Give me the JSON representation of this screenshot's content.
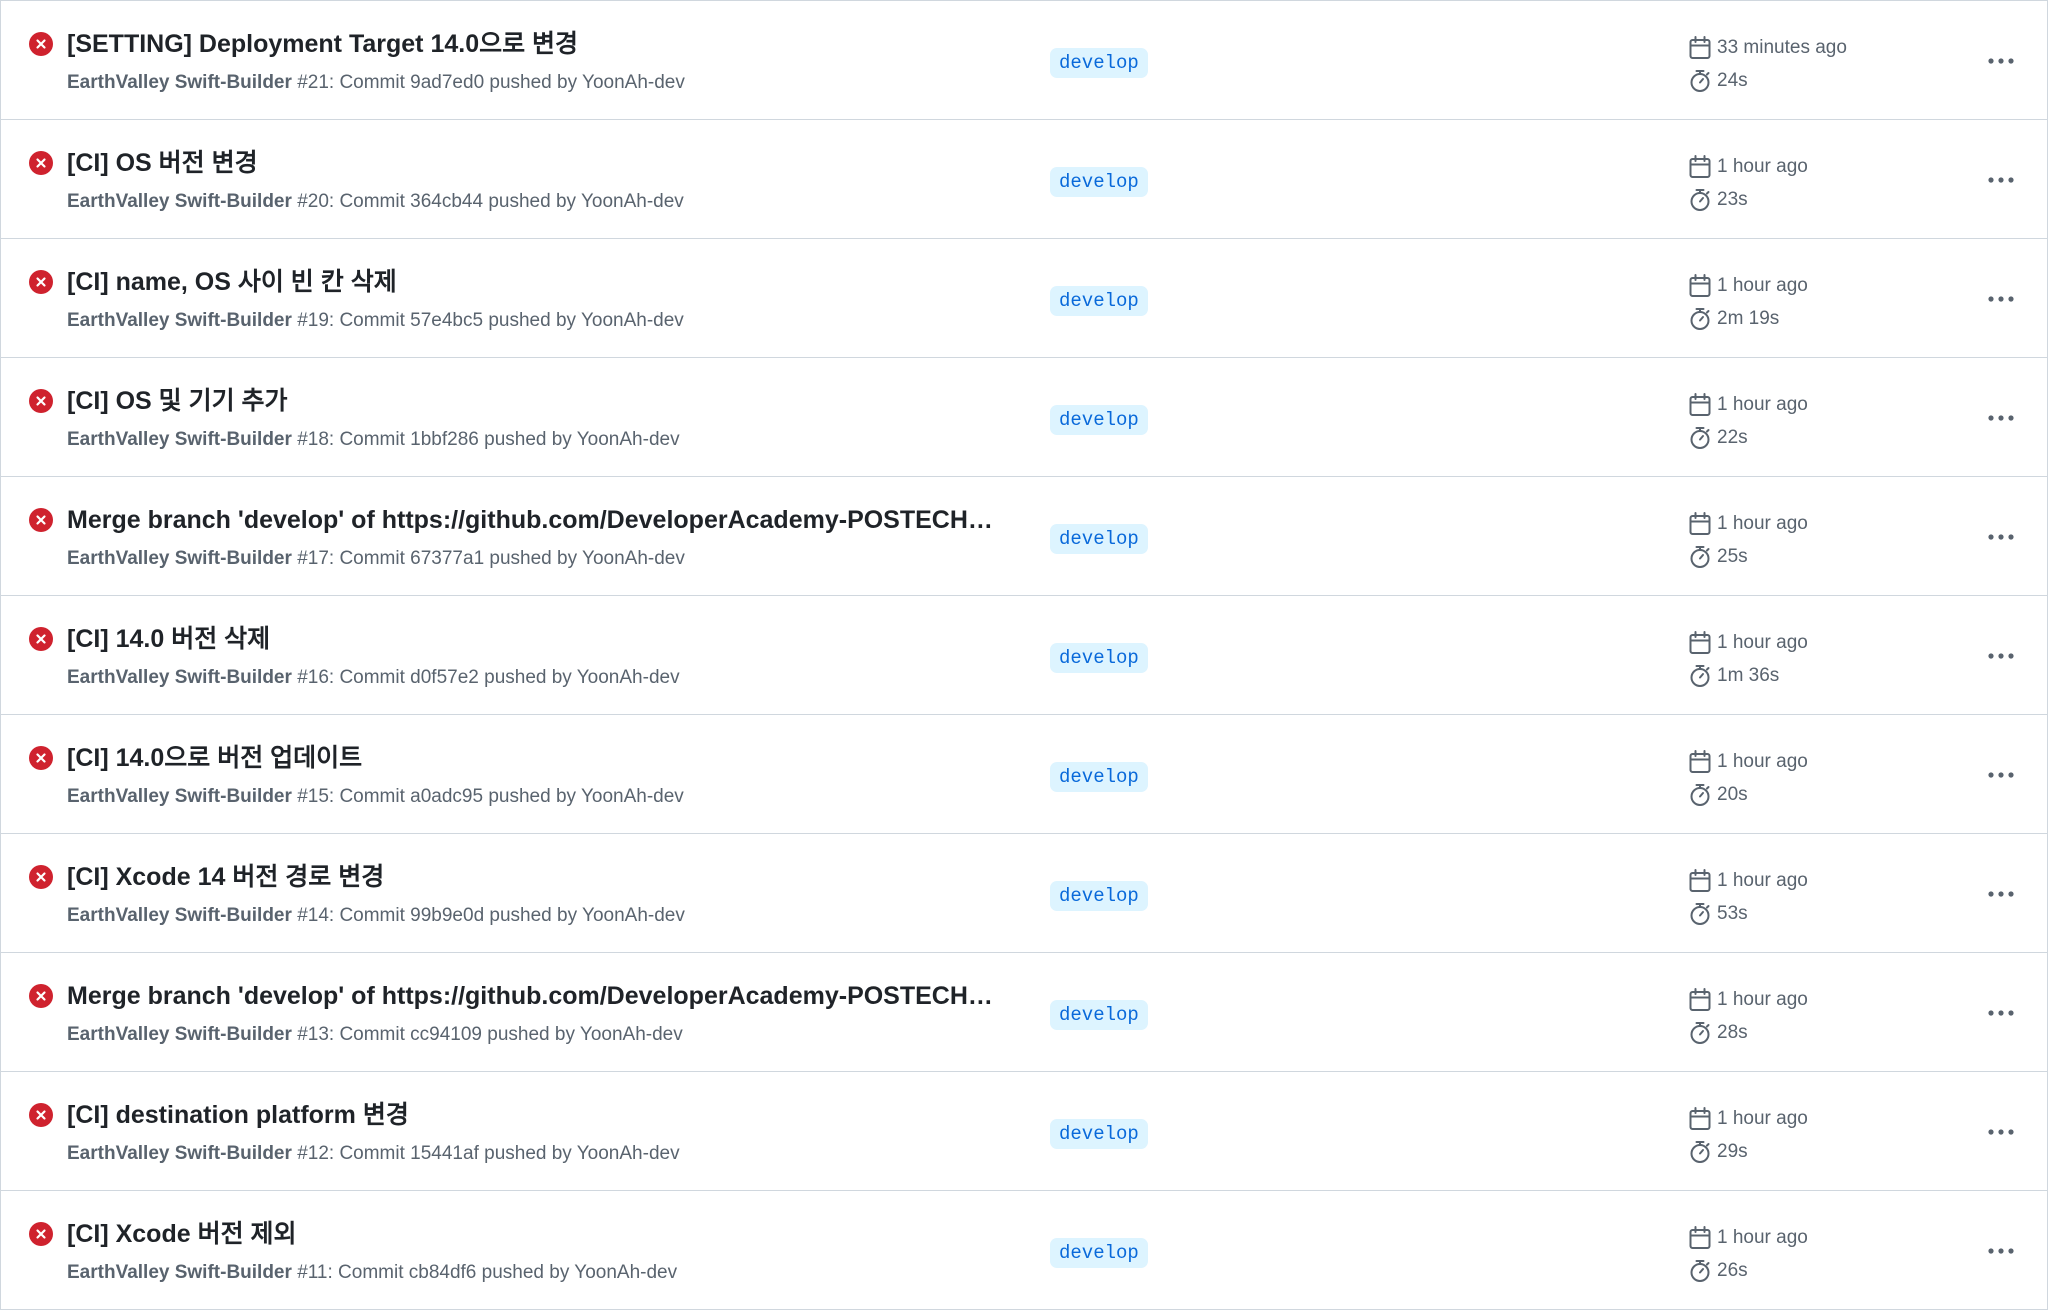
{
  "colors": {
    "failure": "#cf222e",
    "branch_bg": "#ddf4ff",
    "branch_text": "#0969da",
    "muted_text": "#59636e",
    "border": "#d0d7de"
  },
  "icons": {
    "status": "x-circle-fill-icon",
    "date": "calendar-icon",
    "duration": "stopwatch-icon",
    "more": "kebab-horizontal-icon"
  },
  "runs": [
    {
      "title": "[SETTING] Deployment Target 14.0으로 변경",
      "workflow": "EarthValley Swift-Builder",
      "detail": "#21: Commit 9ad7ed0 pushed by YoonAh-dev",
      "branch": "develop",
      "time": "33 minutes ago",
      "duration": "24s"
    },
    {
      "title": "[CI] OS 버전 변경",
      "workflow": "EarthValley Swift-Builder",
      "detail": "#20: Commit 364cb44 pushed by YoonAh-dev",
      "branch": "develop",
      "time": "1 hour ago",
      "duration": "23s"
    },
    {
      "title": "[CI] name, OS 사이 빈 칸 삭제",
      "workflow": "EarthValley Swift-Builder",
      "detail": "#19: Commit 57e4bc5 pushed by YoonAh-dev",
      "branch": "develop",
      "time": "1 hour ago",
      "duration": "2m 19s"
    },
    {
      "title": "[CI] OS 및 기기 추가",
      "workflow": "EarthValley Swift-Builder",
      "detail": "#18: Commit 1bbf286 pushed by YoonAh-dev",
      "branch": "develop",
      "time": "1 hour ago",
      "duration": "22s"
    },
    {
      "title": "Merge branch 'develop' of https://github.com/DeveloperAcademy-POSTECH…",
      "workflow": "EarthValley Swift-Builder",
      "detail": "#17: Commit 67377a1 pushed by YoonAh-dev",
      "branch": "develop",
      "time": "1 hour ago",
      "duration": "25s"
    },
    {
      "title": "[CI] 14.0 버전 삭제",
      "workflow": "EarthValley Swift-Builder",
      "detail": "#16: Commit d0f57e2 pushed by YoonAh-dev",
      "branch": "develop",
      "time": "1 hour ago",
      "duration": "1m 36s"
    },
    {
      "title": "[CI] 14.0으로 버전 업데이트",
      "workflow": "EarthValley Swift-Builder",
      "detail": "#15: Commit a0adc95 pushed by YoonAh-dev",
      "branch": "develop",
      "time": "1 hour ago",
      "duration": "20s"
    },
    {
      "title": "[CI] Xcode 14 버전 경로 변경",
      "workflow": "EarthValley Swift-Builder",
      "detail": "#14: Commit 99b9e0d pushed by YoonAh-dev",
      "branch": "develop",
      "time": "1 hour ago",
      "duration": "53s"
    },
    {
      "title": "Merge branch 'develop' of https://github.com/DeveloperAcademy-POSTECH…",
      "workflow": "EarthValley Swift-Builder",
      "detail": "#13: Commit cc94109 pushed by YoonAh-dev",
      "branch": "develop",
      "time": "1 hour ago",
      "duration": "28s"
    },
    {
      "title": "[CI] destination platform 변경",
      "workflow": "EarthValley Swift-Builder",
      "detail": "#12: Commit 15441af pushed by YoonAh-dev",
      "branch": "develop",
      "time": "1 hour ago",
      "duration": "29s"
    },
    {
      "title": "[CI] Xcode 버전 제외",
      "workflow": "EarthValley Swift-Builder",
      "detail": "#11: Commit cb84df6 pushed by YoonAh-dev",
      "branch": "develop",
      "time": "1 hour ago",
      "duration": "26s"
    }
  ]
}
